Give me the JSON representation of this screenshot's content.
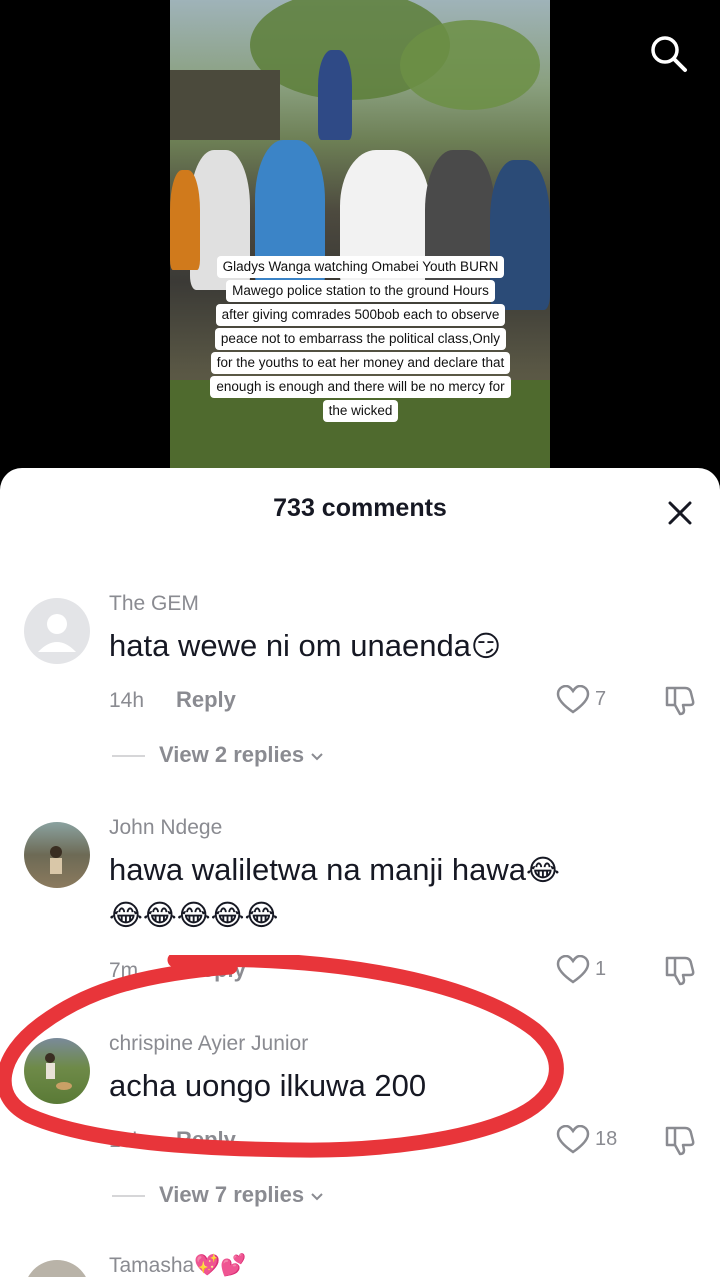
{
  "video": {
    "caption_lines": [
      "Gladys Wanga watching Omabei Youth BURN",
      "Mawego police station to the ground Hours",
      "after giving comrades 500bob each to observe",
      "peace not to embarrass the political class,Only",
      "for the youths to eat her money and declare that",
      "enough is enough and there will be no mercy for",
      "the wicked"
    ],
    "search_icon": "search-icon"
  },
  "comments_sheet": {
    "title": "733 comments",
    "close_icon": "close-icon",
    "comments": [
      {
        "username": "The GEM",
        "text": "hata wewe ni om unaenda",
        "emoji": "😏",
        "time": "14h",
        "reply_label": "Reply",
        "likes": "7",
        "view_replies": "View 2 replies"
      },
      {
        "username": "John Ndege",
        "text": "hawa waliletwa na manji hawa",
        "emoji": "😂",
        "emoji_line": "😂😂😂😂😂",
        "time": "7m",
        "reply_label": "Reply",
        "likes": "1"
      },
      {
        "username": "chrispine Ayier Junior",
        "text": "acha uongo ilkuwa 200",
        "time": "10h",
        "reply_label": "Reply",
        "likes": "18",
        "view_replies": "View 7 replies"
      },
      {
        "username": "Tamasha💖💕"
      }
    ]
  },
  "colors": {
    "annotation": "#e8353a",
    "muted_text": "#8a8b91",
    "primary_text": "#161823"
  }
}
